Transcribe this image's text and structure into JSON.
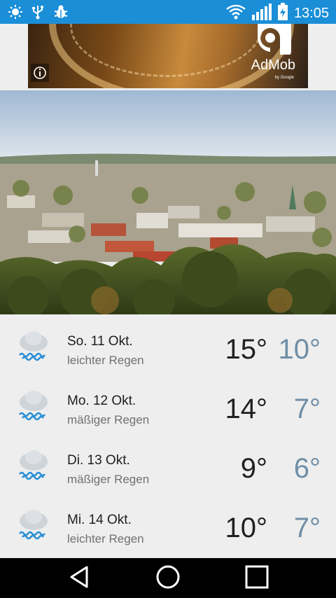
{
  "statusbar": {
    "time": "13:05",
    "icons": [
      "brightness-icon",
      "usb-icon",
      "bug-icon",
      "wifi-icon",
      "signal-icon",
      "battery-charging-icon"
    ]
  },
  "ad": {
    "brand": "AdMob",
    "byline": "by Google",
    "info_icon": "info-icon"
  },
  "forecast": [
    {
      "date": "So. 11 Okt.",
      "desc": "leichter Regen",
      "high": "15°",
      "low": "10°",
      "icon": "rain-cloud-icon"
    },
    {
      "date": "Mo. 12 Okt.",
      "desc": "mäßiger Regen",
      "high": "14°",
      "low": "7°",
      "icon": "rain-cloud-icon"
    },
    {
      "date": "Di. 13 Okt.",
      "desc": "mäßiger Regen",
      "high": "9°",
      "low": "6°",
      "icon": "rain-cloud-icon"
    },
    {
      "date": "Mi. 14 Okt.",
      "desc": "leichter Regen",
      "high": "10°",
      "low": "7°",
      "icon": "rain-cloud-icon"
    }
  ],
  "navbar": {
    "icons": [
      "back-icon",
      "home-icon",
      "recents-icon"
    ]
  },
  "colors": {
    "statusbar": "#1a8ed7",
    "low_temp": "#6f8ea6",
    "background": "#eeeeee"
  }
}
